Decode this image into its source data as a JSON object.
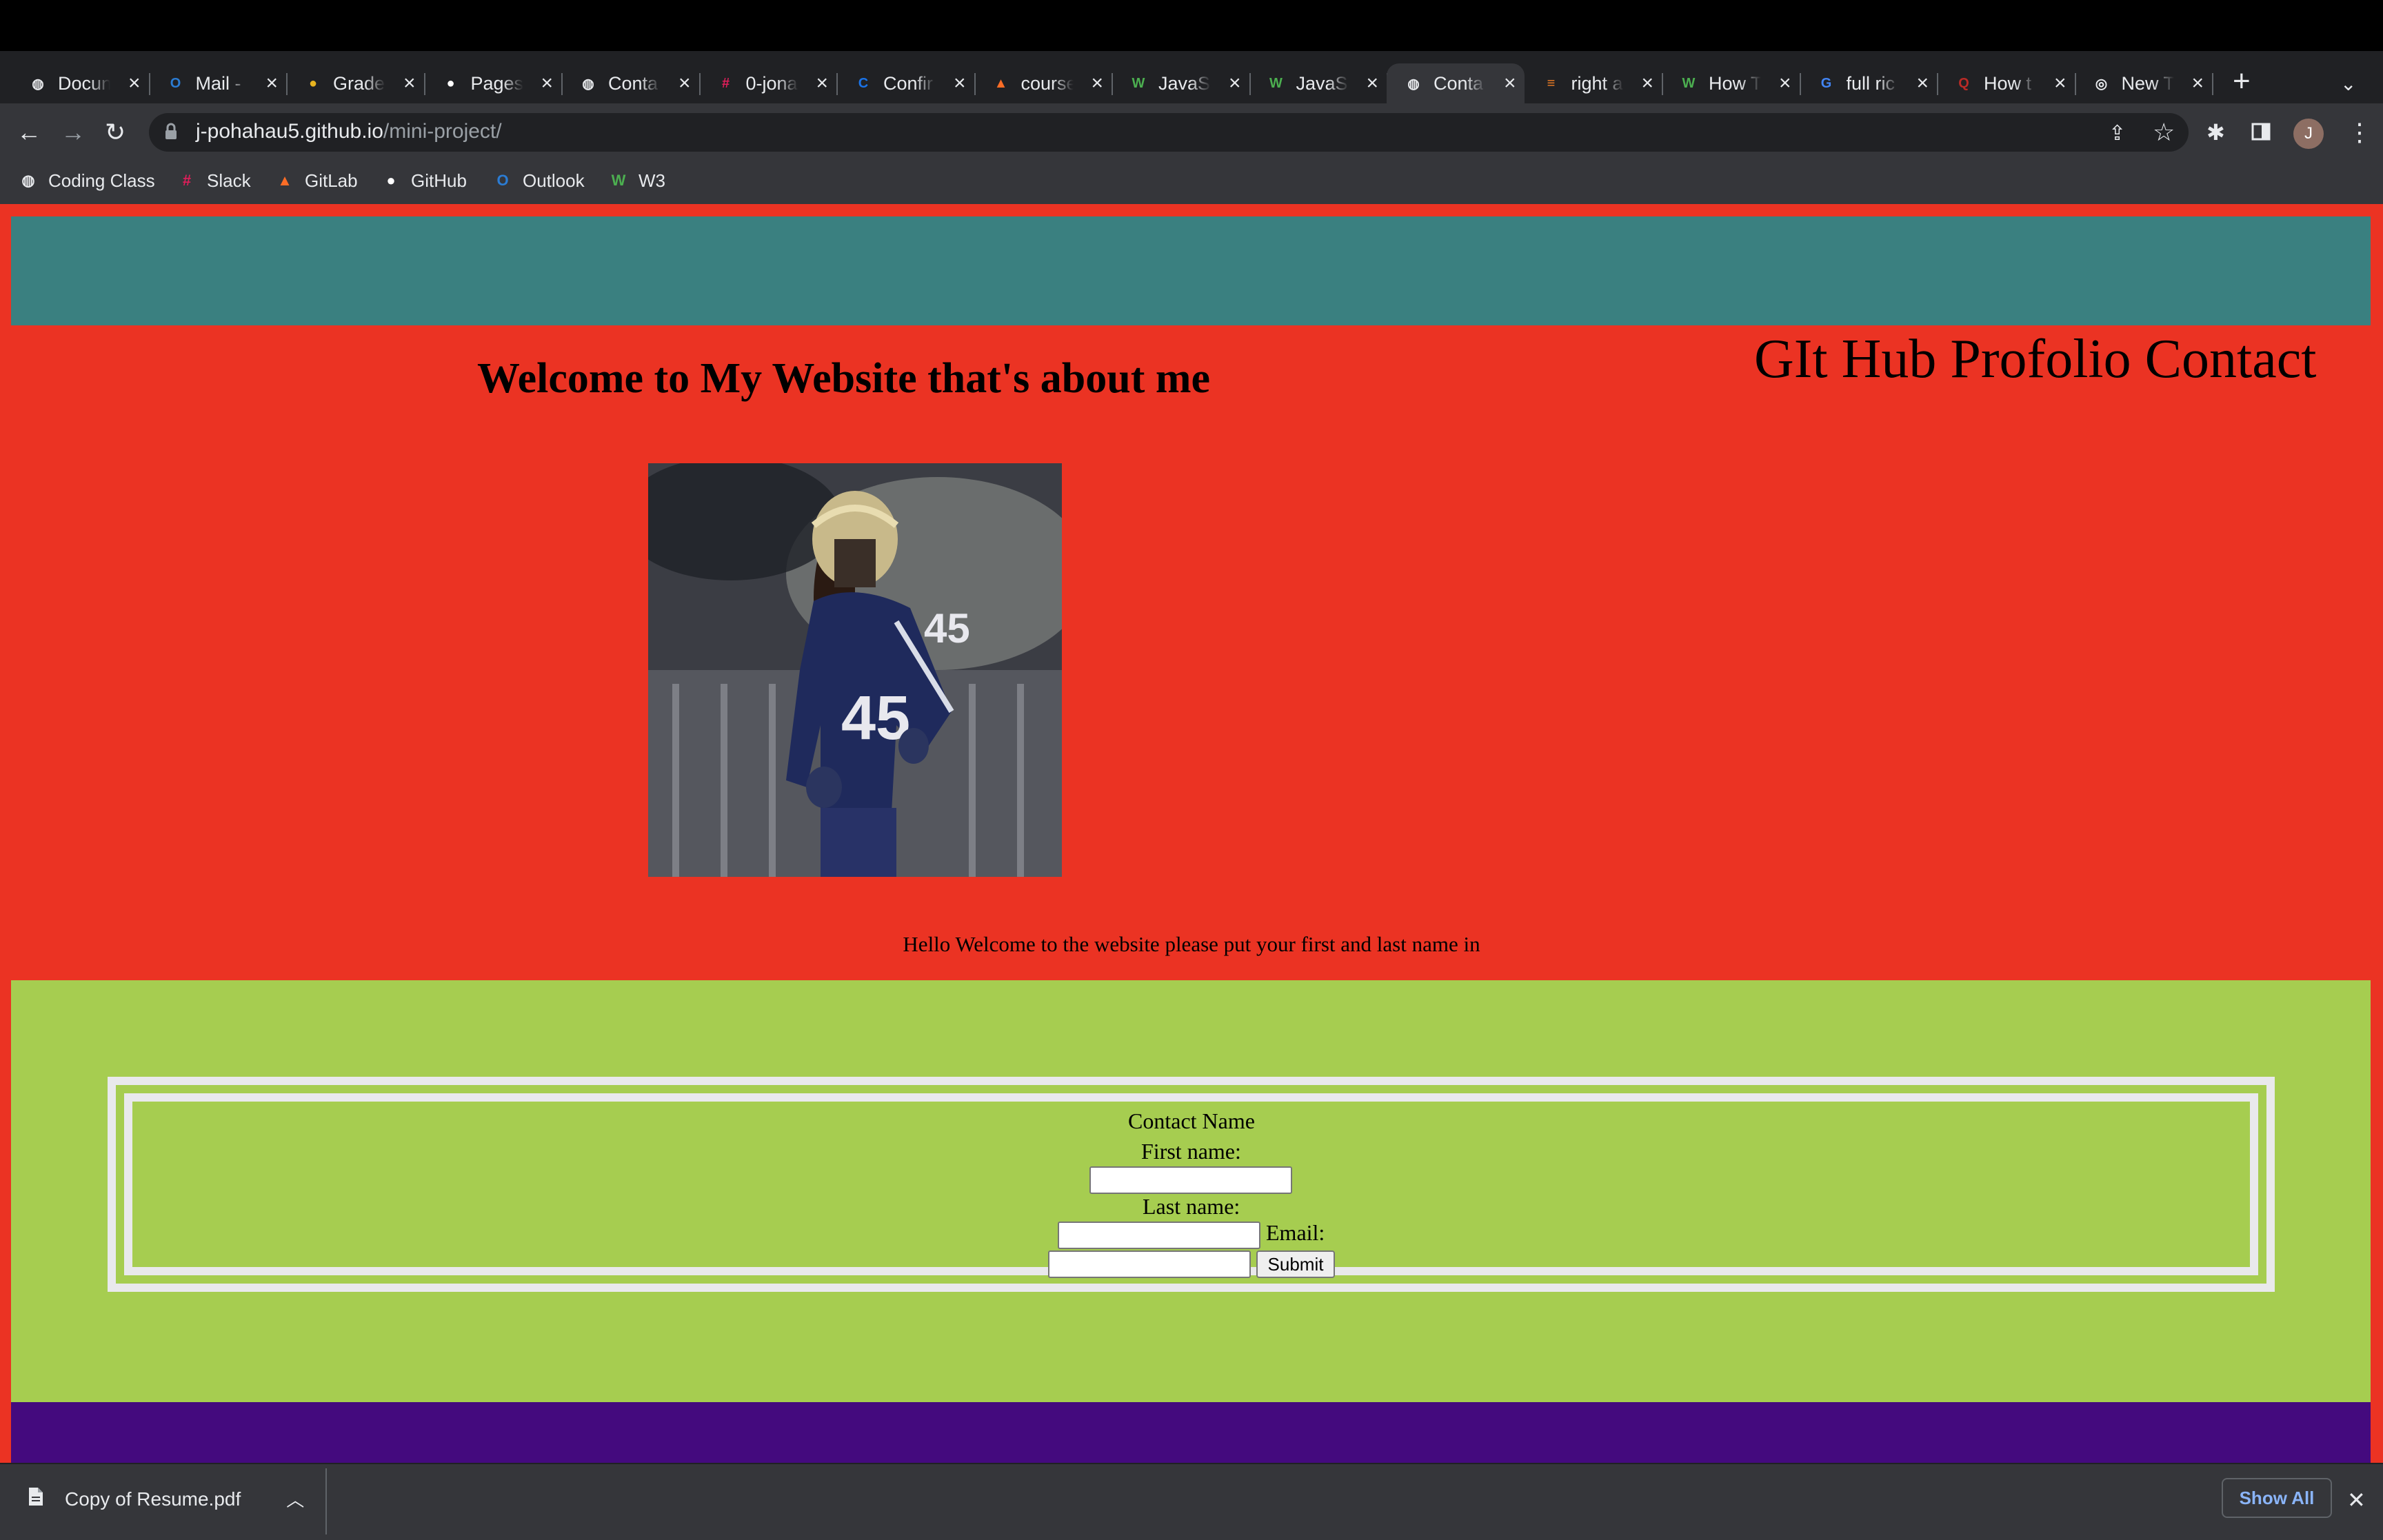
{
  "browser": {
    "tabs": [
      {
        "title": "Docun",
        "icon": "globe-icon",
        "color": "#e8eaed",
        "active": false
      },
      {
        "title": "Mail -",
        "icon": "outlook-icon",
        "color": "#2b7cd3",
        "active": false
      },
      {
        "title": "Grade",
        "icon": "grade-icon",
        "color": "#e7b31f",
        "active": false
      },
      {
        "title": "Pages",
        "icon": "github-icon",
        "color": "#ffffff",
        "active": false
      },
      {
        "title": "Conta",
        "icon": "globe-icon",
        "color": "#e8eaed",
        "active": false
      },
      {
        "title": "0-jona",
        "icon": "slack-icon",
        "color": "#e01e5a",
        "active": false
      },
      {
        "title": "Confir",
        "icon": "confirm-icon",
        "color": "#1a73e8",
        "active": false
      },
      {
        "title": "course",
        "icon": "gitlab-icon",
        "color": "#fc6d26",
        "active": false
      },
      {
        "title": "JavaS",
        "icon": "w3-icon",
        "color": "#4caf50",
        "active": false
      },
      {
        "title": "JavaS",
        "icon": "w3-icon",
        "color": "#4caf50",
        "active": false
      },
      {
        "title": "Conta",
        "icon": "globe-icon",
        "color": "#e8eaed",
        "active": true
      },
      {
        "title": "right a",
        "icon": "stackoverflow-icon",
        "color": "#f48024",
        "active": false
      },
      {
        "title": "How T",
        "icon": "w3-icon",
        "color": "#4caf50",
        "active": false
      },
      {
        "title": "full ric",
        "icon": "google-icon",
        "color": "#4285f4",
        "active": false
      },
      {
        "title": "How t",
        "icon": "quora-icon",
        "color": "#b92b27",
        "active": false
      },
      {
        "title": "New T",
        "icon": "chrome-icon",
        "color": "#e8eaed",
        "active": false
      }
    ],
    "url_host": "j-pohahau5.github.io",
    "url_path": "/mini-project/",
    "profile_initial": "J",
    "bookmarks": [
      {
        "label": "Coding Class",
        "icon": "globe-icon",
        "color": "#e8eaed"
      },
      {
        "label": "Slack",
        "icon": "slack-icon",
        "color": "#e01e5a"
      },
      {
        "label": "GitLab",
        "icon": "gitlab-icon",
        "color": "#fc6d26"
      },
      {
        "label": "GitHub",
        "icon": "github-icon",
        "color": "#ffffff"
      },
      {
        "label": "Outlook",
        "icon": "outlook-icon",
        "color": "#2b7cd3"
      },
      {
        "label": "W3",
        "icon": "w3-icon",
        "color": "#4caf50"
      }
    ]
  },
  "page": {
    "heading": "Welcome to My Website that's about me",
    "nav_links": "GIt Hub Profolio Contact",
    "photo_jersey_number": "45",
    "hello_text": "Hello Welcome to the website please put your first and last name in",
    "form": {
      "legend": "Contact Name",
      "first_name_label": "First name:",
      "last_name_label": "Last name:",
      "email_label": "Email:",
      "submit_label": "Submit",
      "first_name_value": "",
      "last_name_value": "",
      "email_value": ""
    },
    "colors": {
      "background": "#eb3323",
      "header_band": "#3a8080",
      "form_section": "#a6cd50",
      "footer_band": "#440a7e",
      "form_border": "#e9e9ec"
    }
  },
  "downloads": {
    "file_name": "Copy of Resume.pdf",
    "show_all_label": "Show All"
  }
}
